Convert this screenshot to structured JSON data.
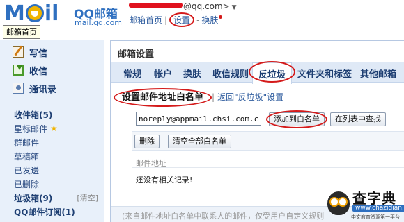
{
  "header": {
    "logo_text": "Mail",
    "brand": "QQ邮箱",
    "domain": "mail.qq.com",
    "tooltip": "邮箱首页",
    "account_suffix": "@qq.com>",
    "nav": {
      "home": "邮箱首页",
      "separator": "|",
      "settings": "设置",
      "dash": "-",
      "skin": "换肤"
    }
  },
  "sidebar": {
    "primary": [
      {
        "label": "写信",
        "icon": "write-icon"
      },
      {
        "label": "收信",
        "icon": "inbox-download-icon"
      },
      {
        "label": "通讯录",
        "icon": "contacts-icon"
      }
    ],
    "folders": {
      "inbox": "收件箱(5)",
      "starred": "星标邮件",
      "group": "群邮件",
      "drafts": "草稿箱",
      "sent": "已发送",
      "deleted": "已删除",
      "junk": "垃圾箱(9)",
      "junk_clear": "[清空]",
      "subscription": "QQ邮件订阅(1)"
    }
  },
  "main": {
    "title": "邮箱设置",
    "tabs": [
      "常规",
      "帐户",
      "换肤",
      "收信规则",
      "反垃圾",
      "文件夹和标签",
      "其他邮箱"
    ],
    "active_tab": "反垃圾",
    "subhead": {
      "current": "设置邮件地址白名单",
      "pipe": "|",
      "back_link": "返回\"反垃圾\"设置"
    },
    "email_input_value": "noreply@appmail.chsi.com.cn",
    "add_button": "添加到白名单",
    "find_button": "在列表中查找",
    "delete_button": "删除",
    "clear_all_button": "清空全部白名单",
    "column_header": "邮件地址",
    "empty_message": "还没有相关记录!",
    "footer_note": "(来自邮件地址白名单中联系人的邮件，仅受用户自定义规则"
  },
  "watermark": {
    "title": "查字典",
    "url": "www.chazidian.com",
    "subtitle": "中文教育资源第一平台"
  },
  "colors": {
    "brand_blue": "#2f70c0",
    "annotation_red": "#d41a1a",
    "sidebar_bg": "#e8f0fa",
    "tab_bar_bg": "#dfe9f6"
  }
}
